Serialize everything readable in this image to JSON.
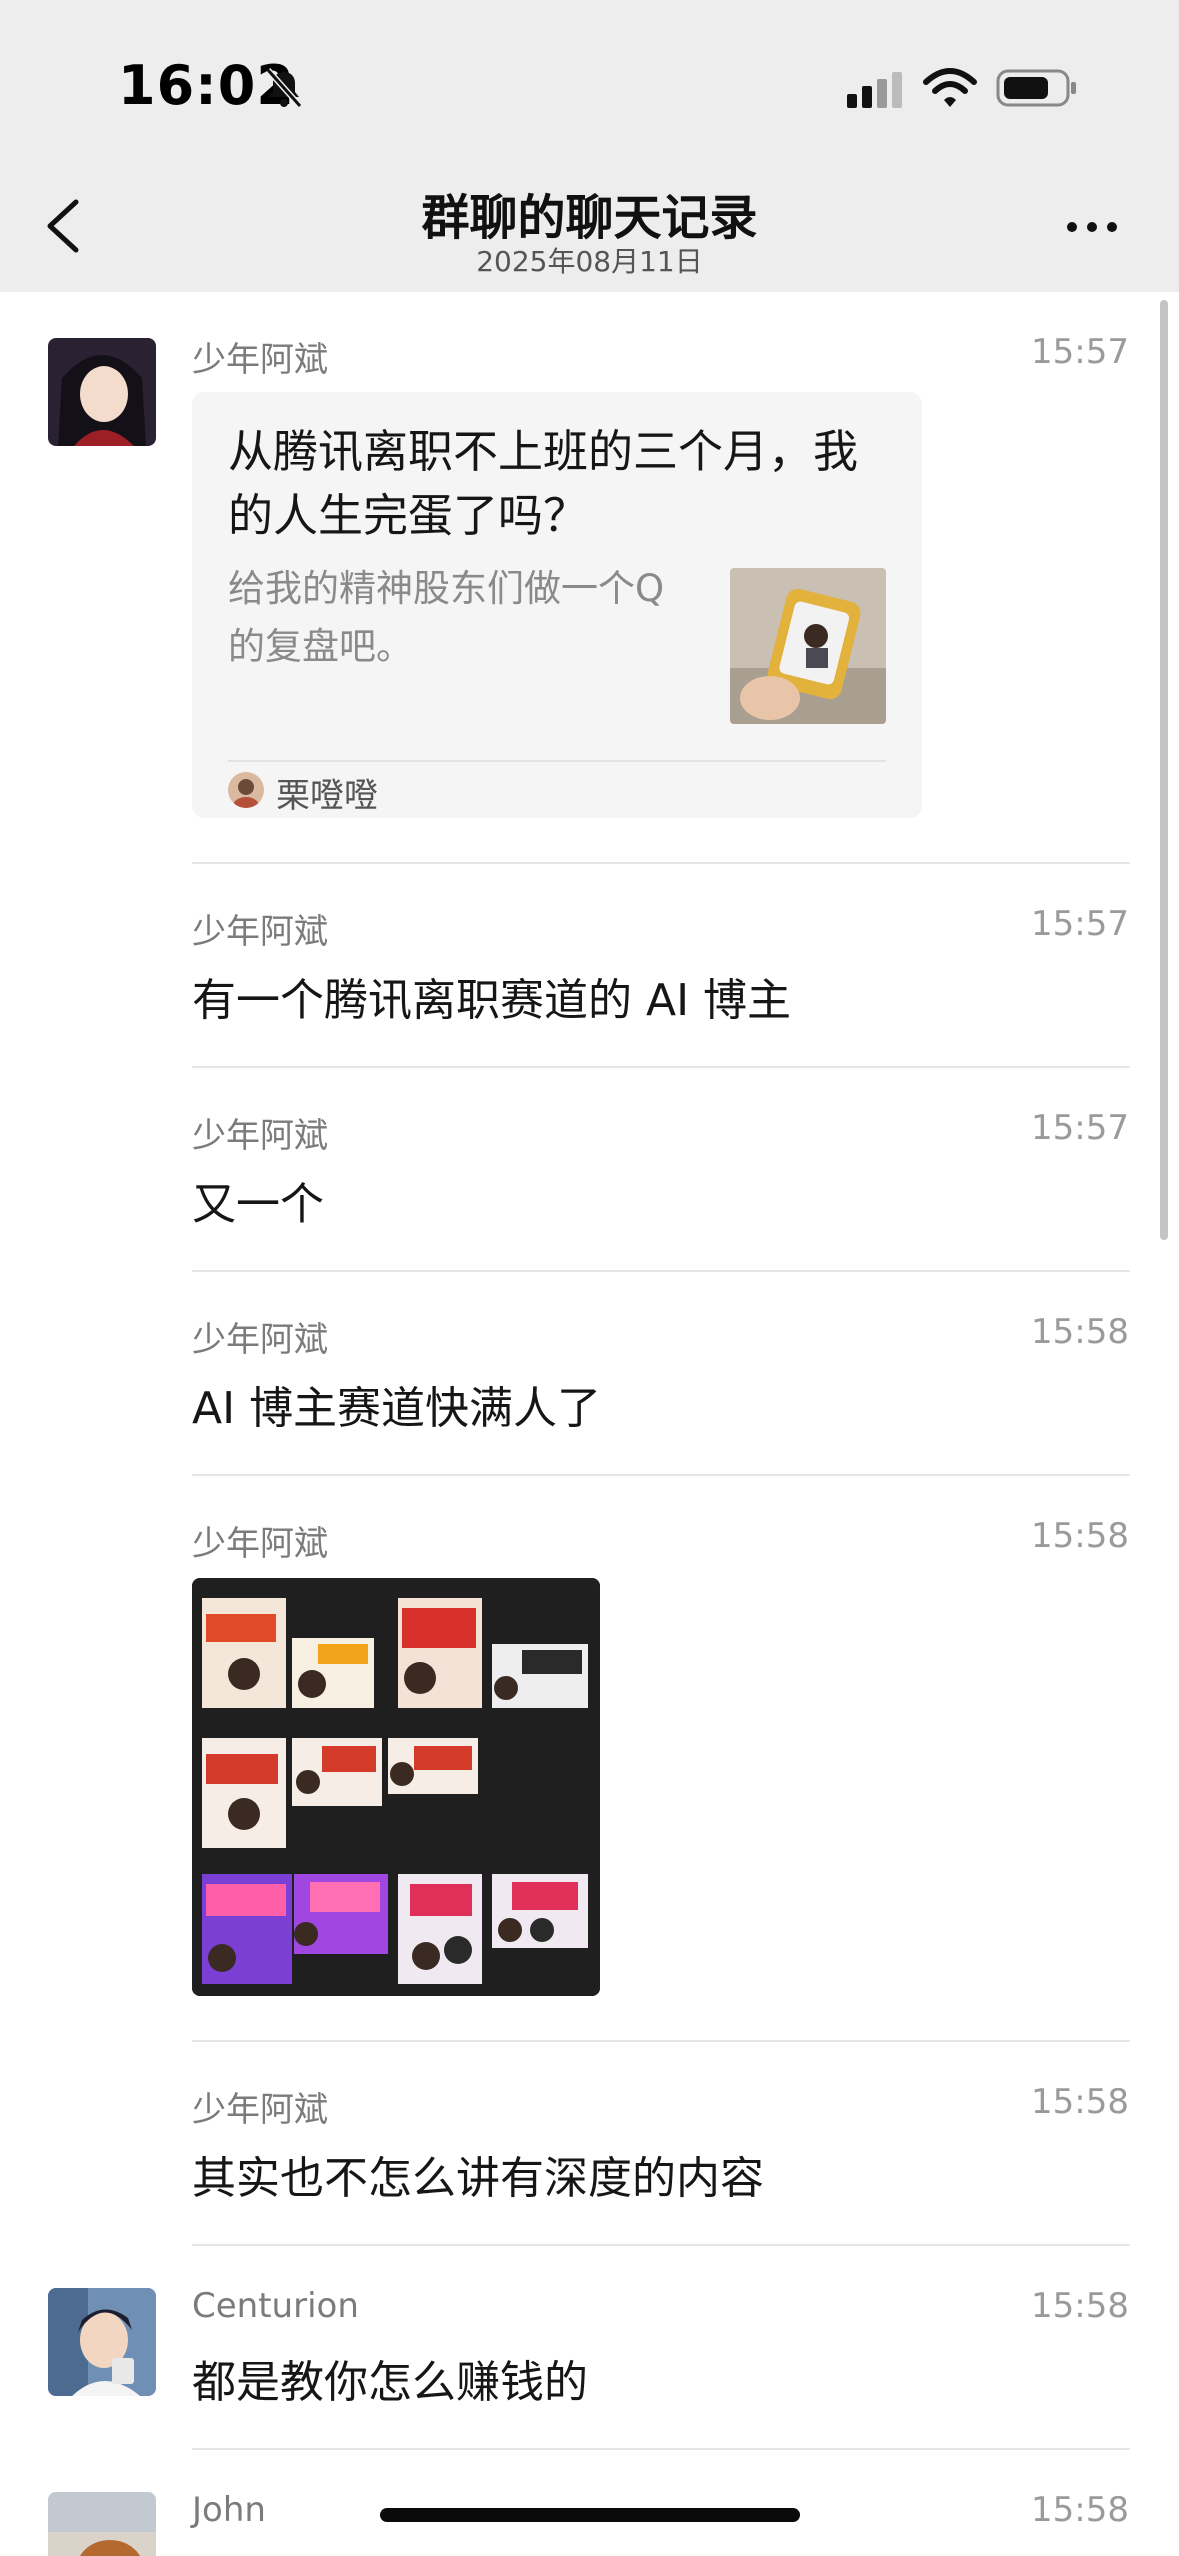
{
  "status_bar": {
    "time": "16:02"
  },
  "nav": {
    "title": "群聊的聊天记录",
    "subtitle": "2025年08月11日"
  },
  "messages": [
    {
      "sender": "少年阿斌",
      "time": "15:57",
      "type": "link-card",
      "card": {
        "title": "从腾讯离职不上班的三个月，我的人生完蛋了吗？",
        "description": "给我的精神股东们做一个Q的复盘吧。",
        "source": "栗噔噔"
      }
    },
    {
      "sender": "少年阿斌",
      "time": "15:57",
      "text": "有一个腾讯离职赛道的 AI 博主"
    },
    {
      "sender": "少年阿斌",
      "time": "15:57",
      "text": "又一个"
    },
    {
      "sender": "少年阿斌",
      "time": "15:58",
      "text": "AI 博主赛道快满人了"
    },
    {
      "sender": "少年阿斌",
      "time": "15:58",
      "type": "image"
    },
    {
      "sender": "少年阿斌",
      "time": "15:58",
      "text": "其实也不怎么讲有深度的内容"
    },
    {
      "sender": "Centurion",
      "time": "15:58",
      "text": "都是教你怎么赚钱的"
    },
    {
      "sender": "John",
      "time": "15:58",
      "text": ""
    }
  ],
  "colors": {
    "nav_bg": "#ededed",
    "card_bg": "#f5f5f5",
    "image_bg": "#1f1f1f"
  },
  "icons": [
    "bell-slash-icon",
    "cellular-signal-icon",
    "wifi-icon",
    "battery-icon",
    "back-chevron-icon",
    "more-dots-icon"
  ]
}
